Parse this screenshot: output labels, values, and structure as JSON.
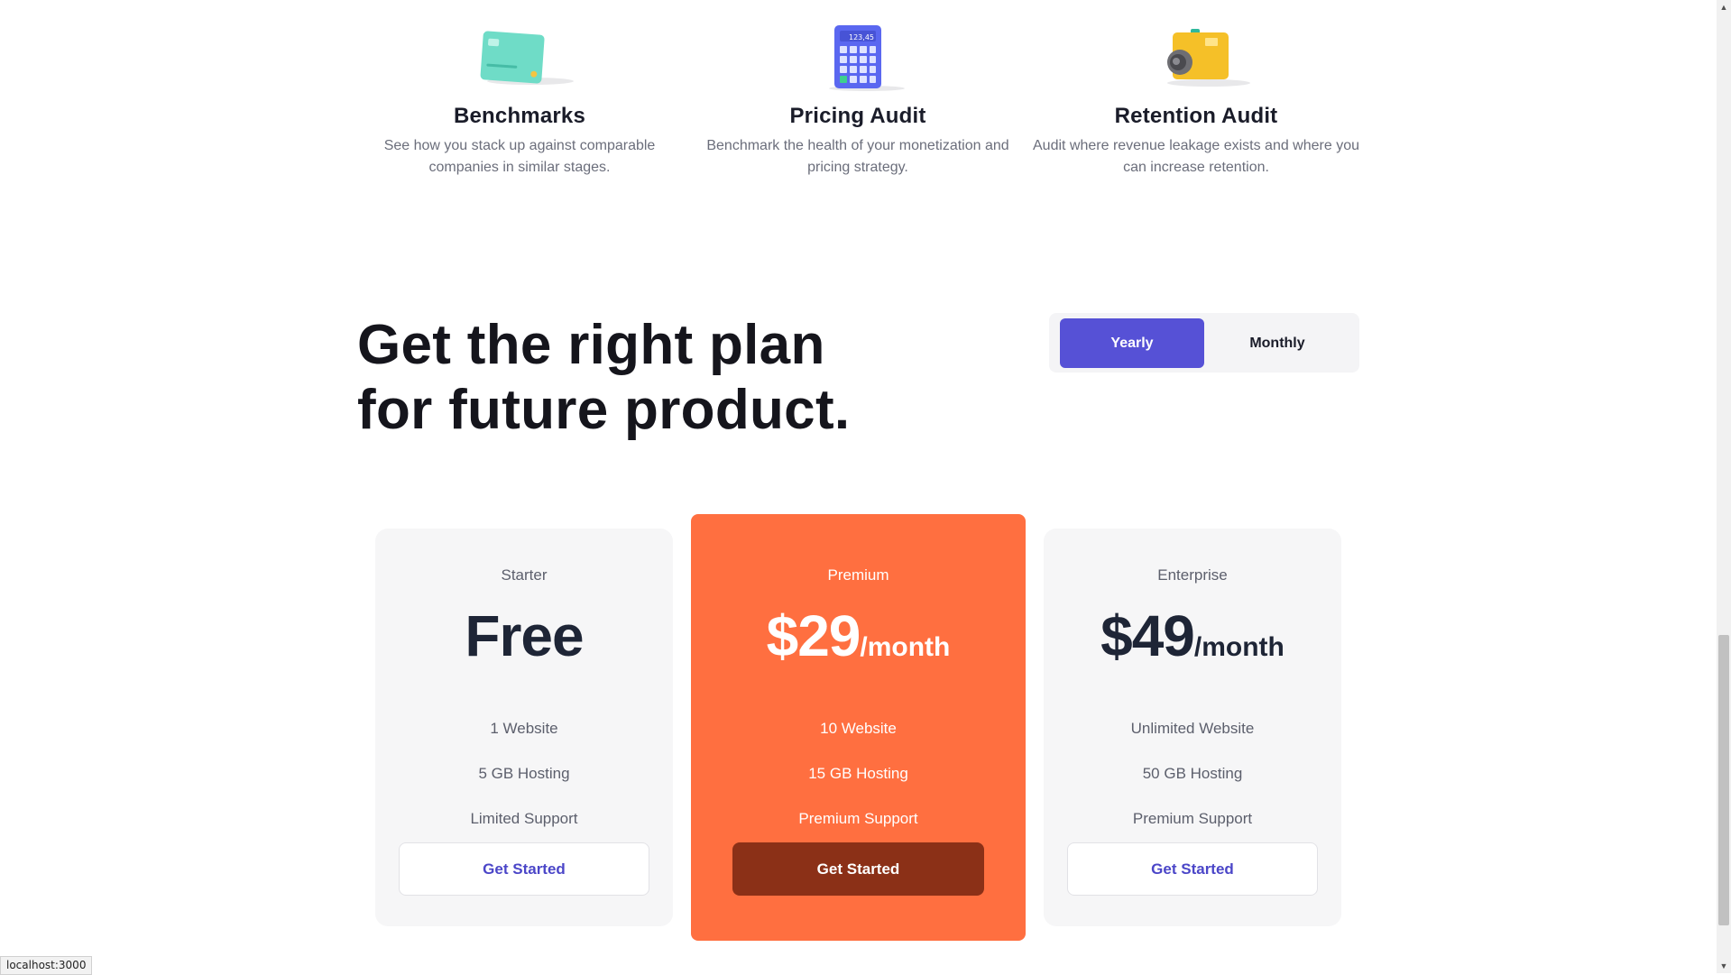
{
  "features": [
    {
      "title": "Benchmarks",
      "description": "See how you stack up against comparable companies in similar stages.",
      "icon": "credit-card-icon"
    },
    {
      "title": "Pricing Audit",
      "description": "Benchmark the health of your monetization and pricing strategy.",
      "icon": "calculator-icon"
    },
    {
      "title": "Retention Audit",
      "description": "Audit where revenue leakage exists and where you can increase retention.",
      "icon": "camera-icon"
    }
  ],
  "heading": {
    "line1": "Get the right plan",
    "line2": "for future product."
  },
  "billing_toggle": {
    "yearly_label": "Yearly",
    "monthly_label": "Monthly",
    "selected": "Yearly"
  },
  "plans": [
    {
      "name": "Starter",
      "amount": "Free",
      "per": "",
      "features": [
        "1 Website",
        "5 GB Hosting",
        "Limited Support"
      ],
      "button": "Get Started"
    },
    {
      "name": "Premium",
      "amount": "$29",
      "per": "/month",
      "features": [
        "10 Website",
        "15 GB Hosting",
        "Premium Support"
      ],
      "button": "Get Started"
    },
    {
      "name": "Enterprise",
      "amount": "$49",
      "per": "/month",
      "features": [
        "Unlimited Website",
        "50 GB Hosting",
        "Premium Support"
      ],
      "button": "Get Started"
    }
  ],
  "status_bar": {
    "url": "localhost:3000"
  },
  "colors": {
    "accent": "#5651d6",
    "premium": "#ff6f40",
    "premium_button": "#8b3017"
  }
}
